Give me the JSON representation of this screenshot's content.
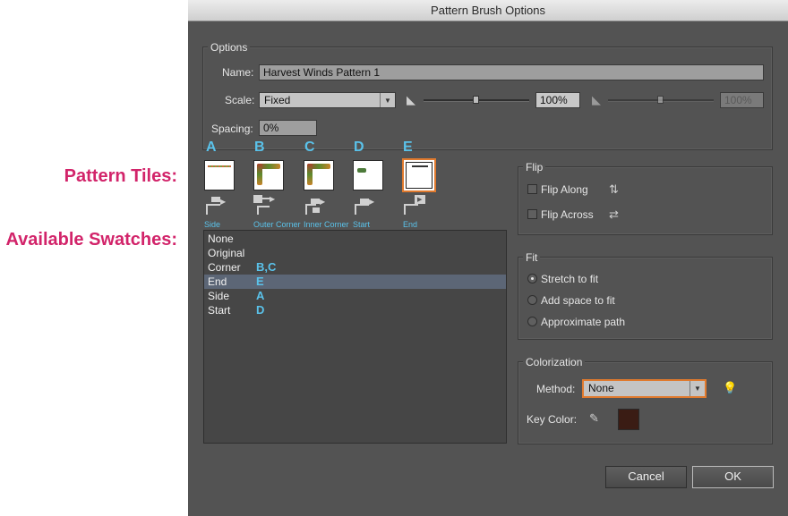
{
  "annotations": {
    "pattern_tiles": "Pattern Tiles:",
    "available_swatches": "Available Swatches:"
  },
  "dialog": {
    "title": "Pattern Brush Options",
    "options": {
      "group_title": "Options",
      "name_label": "Name:",
      "name_value": "Harvest Winds Pattern 1",
      "scale_label": "Scale:",
      "scale_value": "Fixed",
      "scale_percent": "100%",
      "scale_percent_disabled": "100%",
      "spacing_label": "Spacing:",
      "spacing_value": "0%"
    },
    "tiles": [
      {
        "letter": "A",
        "caption": "Side"
      },
      {
        "letter": "B",
        "caption": "Outer Corner"
      },
      {
        "letter": "C",
        "caption": "Inner Corner"
      },
      {
        "letter": "D",
        "caption": "Start"
      },
      {
        "letter": "E",
        "caption": "End"
      }
    ],
    "swatches": [
      {
        "label": "None",
        "annot": ""
      },
      {
        "label": "Original",
        "annot": ""
      },
      {
        "label": "Corner",
        "annot": "B,C"
      },
      {
        "label": "End",
        "annot": "E"
      },
      {
        "label": "Side",
        "annot": "A"
      },
      {
        "label": "Start",
        "annot": "D"
      }
    ],
    "selected_swatch": "End",
    "flip": {
      "group_title": "Flip",
      "along_label": "Flip Along",
      "along_checked": false,
      "across_label": "Flip Across",
      "across_checked": false
    },
    "fit": {
      "group_title": "Fit",
      "options": [
        "Stretch to fit",
        "Add space to fit",
        "Approximate path"
      ],
      "selected": "Stretch to fit"
    },
    "colorization": {
      "group_title": "Colorization",
      "method_label": "Method:",
      "method_value": "None",
      "key_color_label": "Key Color:",
      "key_color": "#3a1c14"
    },
    "buttons": {
      "cancel": "Cancel",
      "ok": "OK"
    }
  },
  "colors": {
    "dialog_bg": "#535353",
    "annotation_pink": "#d2246a",
    "annotation_blue": "#5ac2ea",
    "focus_orange": "#e07a2e"
  }
}
